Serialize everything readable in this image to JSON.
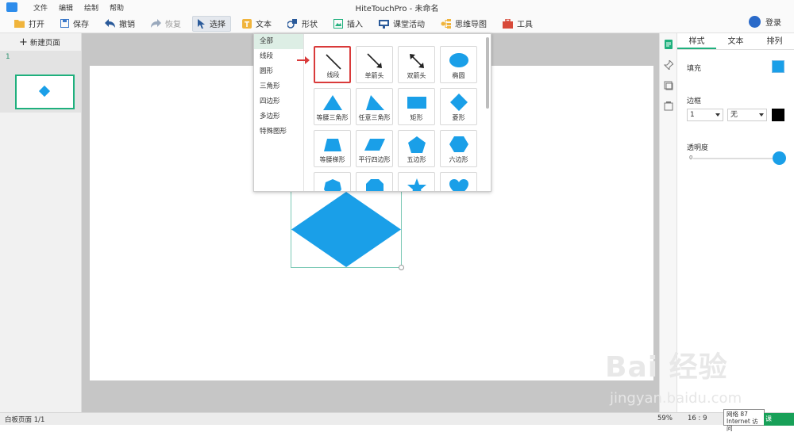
{
  "titlebar": {
    "menu": [
      "文件",
      "编辑",
      "绘制",
      "帮助"
    ],
    "title": "HiteTouchPro - 未命名"
  },
  "toolbar": {
    "open": "打开",
    "save": "保存",
    "undo": "撤销",
    "redo": "恢复",
    "select": "选择",
    "text": "文本",
    "shape": "形状",
    "insert": "插入",
    "classroom": "课堂活动",
    "mindmap": "思维导图",
    "tools": "工具",
    "login": "登录"
  },
  "left_panel": {
    "new_page": "新建页面",
    "slide_number": "1"
  },
  "shape_dropdown": {
    "categories": [
      "全部",
      "线段",
      "圆形",
      "三角形",
      "四边形",
      "多边形",
      "特殊图形"
    ],
    "shapes": [
      {
        "label": "线段",
        "icon": "line-icon"
      },
      {
        "label": "单箭头",
        "icon": "single-arrow-icon"
      },
      {
        "label": "双箭头",
        "icon": "double-arrow-icon"
      },
      {
        "label": "椭圆",
        "icon": "ellipse-icon"
      },
      {
        "label": "等腰三角形",
        "icon": "isosceles-triangle-icon"
      },
      {
        "label": "任意三角形",
        "icon": "scalene-triangle-icon"
      },
      {
        "label": "矩形",
        "icon": "rectangle-icon"
      },
      {
        "label": "菱形",
        "icon": "rhombus-icon"
      },
      {
        "label": "等腰梯形",
        "icon": "trapezoid-icon"
      },
      {
        "label": "平行四边形",
        "icon": "parallelogram-icon"
      },
      {
        "label": "五边形",
        "icon": "pentagon-icon"
      },
      {
        "label": "六边形",
        "icon": "hexagon-icon"
      },
      {
        "label": "",
        "icon": "heptagon-icon"
      },
      {
        "label": "",
        "icon": "octagon-icon"
      },
      {
        "label": "",
        "icon": "star-icon"
      },
      {
        "label": "",
        "icon": "heart-icon"
      }
    ]
  },
  "properties": {
    "tabs": [
      "样式",
      "文本",
      "排列"
    ],
    "fill_label": "填充",
    "border_label": "边框",
    "border_width": "1",
    "border_style": "无",
    "opacity_label": "透明度",
    "opacity_value": "0"
  },
  "statusbar": {
    "page_info": "白板页面 1/1",
    "zoom": "59%",
    "ratio": "16 : 9",
    "network_line1": "网络  87",
    "network_line2": "Internet 访问",
    "green_tab": "课"
  },
  "watermark": {
    "brand": "Bai 经验",
    "url": "jingyan.baidu.com"
  },
  "colors": {
    "accent_green": "#1fb07d",
    "shape_blue": "#1a9fe8",
    "highlight_red": "#d93a3a"
  }
}
